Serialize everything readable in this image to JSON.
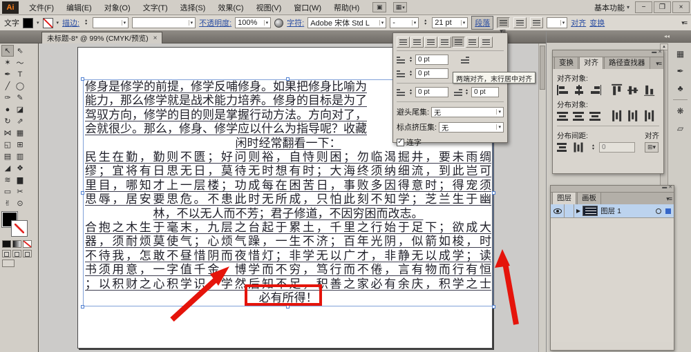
{
  "window": {
    "app_badge": "Ai",
    "workspace": "基本功能",
    "minimize": "−",
    "restore": "❐",
    "close": "×"
  },
  "menubar": {
    "items": [
      "文件(F)",
      "编辑(E)",
      "对象(O)",
      "文字(T)",
      "选择(S)",
      "效果(C)",
      "视图(V)",
      "窗口(W)",
      "帮助(H)"
    ]
  },
  "controlbar": {
    "object_label": "文字",
    "stroke_label": "描边:",
    "opacity_label": "不透明度:",
    "opacity_value": "100%",
    "character_label": "字符:",
    "font_value": "Adobe 宋体 Std L",
    "style_value": "-",
    "size_value": "21 pt",
    "paragraph_label": "段落",
    "align_label": "对齐",
    "transform_label": "变换"
  },
  "tabbar": {
    "title": "未标题-8* @ 99% (CMYK/预览)",
    "close": "×"
  },
  "toolbar": {
    "tools": [
      {
        "name": "selection",
        "glyph": "↖"
      },
      {
        "name": "direct-selection",
        "glyph": "⇖"
      },
      {
        "name": "magic-wand",
        "glyph": "✶"
      },
      {
        "name": "lasso",
        "glyph": "〜"
      },
      {
        "name": "pen",
        "glyph": "✒"
      },
      {
        "name": "type",
        "glyph": "T"
      },
      {
        "name": "line-segment",
        "glyph": "╱"
      },
      {
        "name": "ellipse",
        "glyph": "◯"
      },
      {
        "name": "paintbrush",
        "glyph": "✑"
      },
      {
        "name": "pencil",
        "glyph": "✎"
      },
      {
        "name": "blob-brush",
        "glyph": "●"
      },
      {
        "name": "eraser",
        "glyph": "◪"
      },
      {
        "name": "rotate",
        "glyph": "↻"
      },
      {
        "name": "scale",
        "glyph": "⇗"
      },
      {
        "name": "width",
        "glyph": "⋈"
      },
      {
        "name": "free-transform",
        "glyph": "▦"
      },
      {
        "name": "shape-builder",
        "glyph": "◱"
      },
      {
        "name": "perspective-grid",
        "glyph": "⊞"
      },
      {
        "name": "mesh",
        "glyph": "▤"
      },
      {
        "name": "gradient",
        "glyph": "▥"
      },
      {
        "name": "eyedropper",
        "glyph": "◢"
      },
      {
        "name": "blend",
        "glyph": "❖"
      },
      {
        "name": "symbol-sprayer",
        "glyph": "≋"
      },
      {
        "name": "column-graph",
        "glyph": "▆"
      },
      {
        "name": "artboard",
        "glyph": "▭"
      },
      {
        "name": "slice",
        "glyph": "✂"
      },
      {
        "name": "hand",
        "glyph": "✌"
      },
      {
        "name": "zoom",
        "glyph": "⊙"
      }
    ]
  },
  "document": {
    "lines": [
      "修身是修学的前提，修学反哺修身。如果把修身比喻为",
      "能力，那么修学就是战术能力培养。修身的目标是为了",
      "驾驭方向，修学的目的则是掌握行动方法。方向对了，",
      "会就很少。那么，修身、修学应以什么为指导呢？收藏",
      "闲时经常翻看一下：",
      "民生在勤，勤则不匮；好问则裕，自恃则困；勿临渴掘井，要未雨绸",
      "缪；宜将有日思无日，莫待无时想有时；大海终须纳细流，到此岂可",
      "里目，哪知才上一层楼；功成每在困苦日，事败多因得意时；得宠须",
      "思辱，居安要思危。不患此时无所成，只怕此刻不知学；芝兰生于幽",
      "林，不以无人而不芳；君子修道，不因穷困而改志。",
      "合抱之木生于毫末，九层之台起于累土，千里之行始于足下；欲成大",
      "器，须耐烦莫使气；心烦气躁，一生不济；百年光阴，似箭如梭，时",
      "不待我，怎敢不昼惜阴而夜惜灯；非学无以广才，非静无以成学；读",
      "书须用意，一字值千金，博学而不穷，笃行而不倦，言有物而行有恒",
      "；以积财之心积学识，学然后知不足，积善之家必有余庆，积学之士",
      "必有所得！"
    ]
  },
  "paragraph_popup": {
    "left_indent": "0 pt",
    "first_line_indent": "0 pt",
    "space_before": "0 pt",
    "space_after": "0 pt",
    "kinsoku_label": "避头尾集:",
    "kinsoku_value": "无",
    "mojikumi_label": "标点挤压集:",
    "mojikumi_value": "无",
    "hyphenate_label": "连字"
  },
  "tooltip": {
    "text": "两端对齐，末行居中对齐"
  },
  "align_panel": {
    "tabs": [
      "变换",
      "对齐",
      "路径查找器"
    ],
    "align_objects_label": "对齐对象:",
    "distribute_objects_label": "分布对象:",
    "distribute_spacing_label": "分布间距:",
    "align_to_label": "对齐",
    "spacing_value": "0"
  },
  "layers_panel": {
    "tabs": [
      "图层",
      "画板"
    ],
    "layer_name": "图层 1"
  },
  "annotations": {
    "highlight_text": "必有所得！",
    "accent_color": "#e5140b"
  },
  "dock_icons": [
    {
      "name": "swatches",
      "glyph": "▦"
    },
    {
      "name": "brushes",
      "glyph": "✒"
    },
    {
      "name": "symbols",
      "glyph": "♣"
    },
    {
      "name": "appearance",
      "glyph": "❋"
    },
    {
      "name": "transparency",
      "glyph": "▱"
    }
  ]
}
